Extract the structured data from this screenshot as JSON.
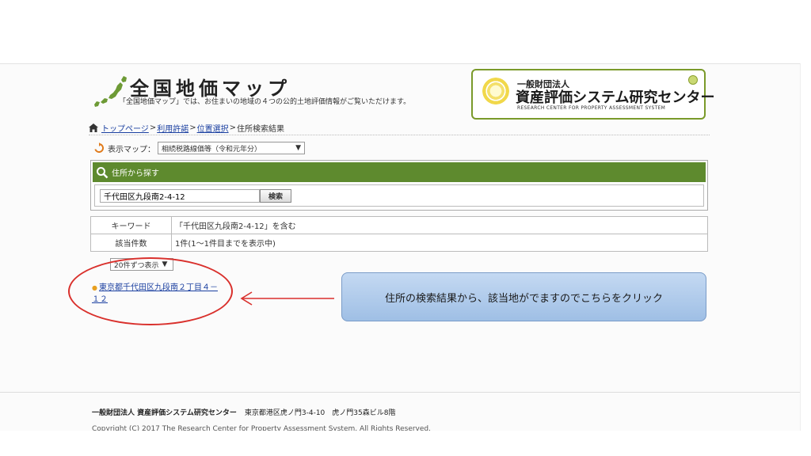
{
  "header": {
    "logo_title": "全国地価マップ",
    "logo_subtitle": "「全国地価マップ」では、お住まいの地域の４つの公的土地評価情報がご覧いただけます。",
    "banner_org_type": "一般財団法人",
    "banner_org_name": "資産評価システム研究センター",
    "banner_org_english": "RESEARCH CENTER FOR PROPERTY ASSESSMENT SYSTEM"
  },
  "breadcrumb": {
    "items": [
      {
        "label": "トップページ"
      },
      {
        "label": "利用許諾"
      },
      {
        "label": "位置選択"
      }
    ],
    "current": "住所検索結果",
    "separator": ">"
  },
  "map_select": {
    "label": "表示マップ：",
    "value": "相続税路線価等（令和元年分）"
  },
  "search": {
    "header": "住所から探す",
    "input_value": "千代田区九段南2-4-12",
    "button_label": "検索"
  },
  "info_table": {
    "rows": [
      {
        "header": "キーワード",
        "value": "「千代田区九段南2-4-12」を含む"
      },
      {
        "header": "該当件数",
        "value": "1件(1～1件目までを表示中)"
      }
    ]
  },
  "per_page": {
    "value": "20件ずつ表示"
  },
  "results": [
    {
      "label": "東京都千代田区九段南２丁目４－１２"
    }
  ],
  "callout": {
    "text": "住所の検索結果から、該当地がでますのでこちらをクリック"
  },
  "footer": {
    "org": "一般財団法人 資産評価システム研究センター",
    "address": "東京都港区虎ノ門3-4-10　虎ノ門35森ビル8階",
    "copyright": "Copyright (C) 2017 The Research Center for Property Assessment System. All Rights Reserved."
  },
  "colors": {
    "green_header": "#5e8a2e",
    "link": "#1a3fa0",
    "annotation_red": "#d9302c",
    "callout_blue": "#aac6ea"
  }
}
